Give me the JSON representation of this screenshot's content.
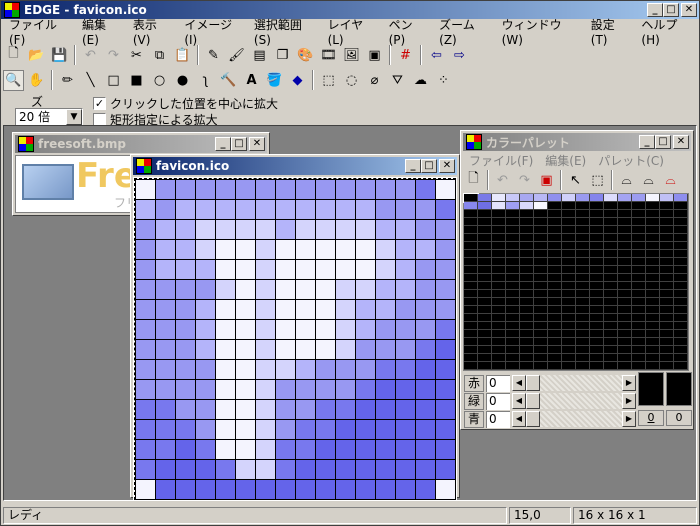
{
  "app": {
    "title": "EDGE - favicon.ico"
  },
  "menu": [
    "ファイル(F)",
    "編集(E)",
    "表示(V)",
    "イメージ(I)",
    "選択範囲(S)",
    "レイヤ(L)",
    "ペン(P)",
    "ズーム(Z)",
    "ウィンドウ(W)",
    "設定(T)",
    "ヘルプ(H)"
  ],
  "zoom": {
    "label": "ズーム",
    "value": "20 倍"
  },
  "options": {
    "center_zoom_label": "クリックした位置を中心に拡大",
    "center_zoom_checked": true,
    "rect_zoom_label": "矩形指定による拡大",
    "rect_zoom_checked": false
  },
  "windows": {
    "freesoft": {
      "title": "freesoft.bmp",
      "preview_text": "Free",
      "preview_sub": "フリ"
    },
    "favicon": {
      "title": "favicon.ico"
    },
    "palette": {
      "title": "カラーパレット"
    }
  },
  "palette_menu": [
    "ファイル(F)",
    "編集(E)",
    "パレット(C)"
  ],
  "rgb": {
    "r_label": "赤",
    "g_label": "緑",
    "b_label": "青",
    "r": "0",
    "g": "0",
    "b": "0"
  },
  "swatch_labels": {
    "fg": "0",
    "bg": "0"
  },
  "status": {
    "ready": "レディ",
    "coords": "15,0",
    "size": "16 x 16 x 1"
  },
  "colors": {
    "c0": "#f4f4fe",
    "c1": "#d4d4fc",
    "c2": "#b4b4fa",
    "c3": "#9898f2",
    "c4": "#7878ee",
    "c5": "#6464ea",
    "accent": "#0a246a"
  },
  "pixel_grid": [
    "0333333333333340",
    "2322222222223334",
    "3221111211112233",
    "3221001000001223",
    "3222001000001233",
    "3333101000112233",
    "3332001000122333",
    "3332001000123334",
    "3332001000133345",
    "3333001123334455",
    "3333001333345555",
    "4433001334455555",
    "4443001344555555",
    "4454001445555555",
    "4555411455555555",
    "0555555555555550"
  ],
  "palette_row1": [
    "#000000",
    "#7a7ae8",
    "#e8e8fc",
    "#c8c8f8",
    "#a8a8f0",
    "#b8b8f4",
    "#9090ee",
    "#d0d0fa",
    "#9a9af0",
    "#8484ec",
    "#dcdcfc",
    "#a4a4f2",
    "#9c9cf0",
    "#f4f4fe",
    "#c0c0f6",
    "#8e8eee"
  ],
  "palette_row2": [
    "#8888ec",
    "#6f6fe6",
    "#e4e4fc",
    "#a0a0f2",
    "#d8d8fc",
    "#f8f8ff",
    "#000000",
    "#000000",
    "#000000",
    "#000000",
    "#000000",
    "#000000",
    "#000000",
    "#000000",
    "#000000",
    "#000000"
  ]
}
